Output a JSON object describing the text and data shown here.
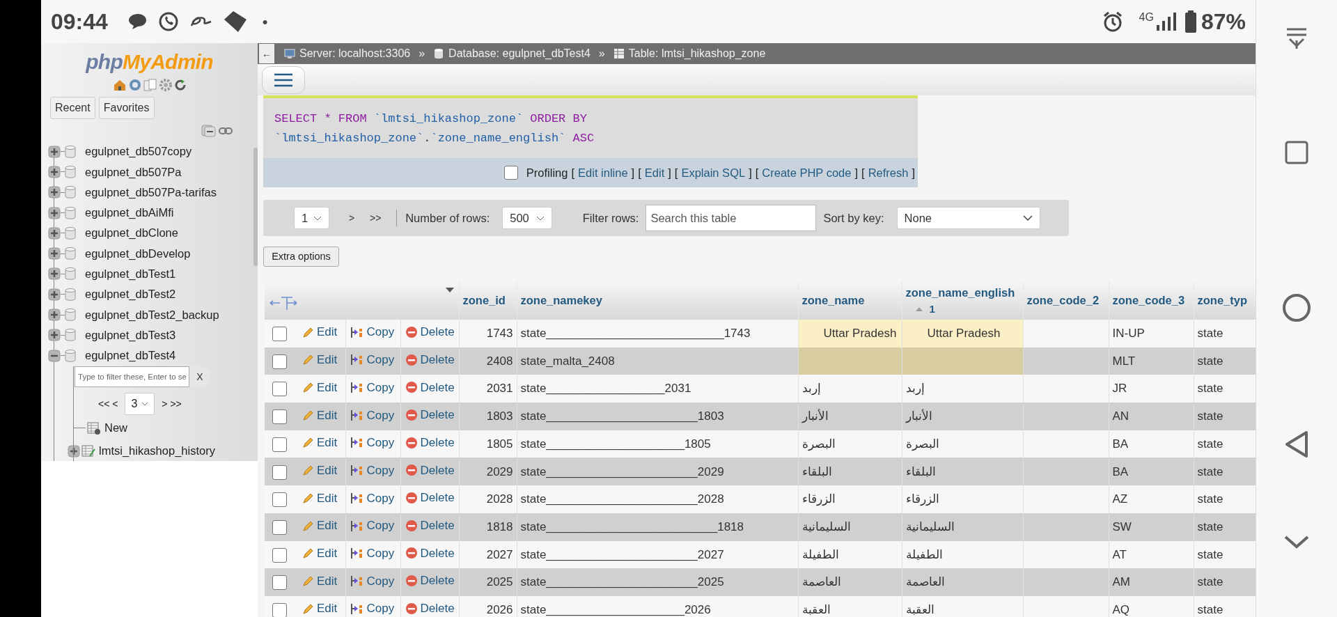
{
  "status_bar": {
    "time": "09:44",
    "dot": "•",
    "network": "4G",
    "battery": "87%"
  },
  "sidebar": {
    "logo": [
      "php",
      "MyAdmin"
    ],
    "buttons": [
      "Recent",
      "Favorites"
    ],
    "databases": [
      {
        "name": "egulpnet_db507copy",
        "expanded": false
      },
      {
        "name": "egulpnet_db507Pa",
        "expanded": false
      },
      {
        "name": "egulpnet_db507Pa-tarifas",
        "expanded": false
      },
      {
        "name": "egulpnet_dbAiMfi",
        "expanded": false
      },
      {
        "name": "egulpnet_dbClone",
        "expanded": false
      },
      {
        "name": "egulpnet_dbDevelop",
        "expanded": false
      },
      {
        "name": "egulpnet_dbTest1",
        "expanded": false
      },
      {
        "name": "egulpnet_dbTest2",
        "expanded": false
      },
      {
        "name": "egulpnet_dbTest2_backup",
        "expanded": false
      },
      {
        "name": "egulpnet_dbTest3",
        "expanded": false
      },
      {
        "name": "egulpnet_dbTest4",
        "expanded": true,
        "filter": {
          "placeholder": "Type to filter these, Enter to se",
          "clear": "X"
        },
        "pager": {
          "prev": "<< <",
          "page": "3",
          "next": "> >>"
        },
        "children": [
          {
            "kind": "new",
            "name": "New"
          },
          {
            "kind": "table",
            "name": "lmtsi_hikashop_history"
          }
        ]
      }
    ]
  },
  "breadcrumb": {
    "back": "←",
    "items": [
      {
        "kind": "server",
        "label": "Server: localhost:3306"
      },
      {
        "kind": "database",
        "label": "Database: egulpnet_dbTest4"
      },
      {
        "kind": "table",
        "label": "Table: lmtsi_hikashop_zone"
      }
    ],
    "separator": "»"
  },
  "sql": {
    "lines": [
      [
        {
          "kind": "keyword",
          "text": "SELECT"
        },
        {
          "kind": "keyword",
          "text": " * FROM "
        },
        {
          "kind": "ident",
          "text": "`lmtsi_hikashop_zone`"
        },
        {
          "kind": "keyword",
          "text": " ORDER BY"
        }
      ],
      [
        {
          "kind": "ident",
          "text": "`lmtsi_hikashop_zone`"
        },
        {
          "kind": "plain",
          "text": "."
        },
        {
          "kind": "ident",
          "text": "`zone_name_english`"
        },
        {
          "kind": "keyword",
          "text": " ASC"
        }
      ]
    ],
    "profiling": {
      "label": "Profiling",
      "checked": false
    },
    "links": [
      {
        "open": "[",
        "label": "Edit inline",
        "close": "]"
      },
      {
        "open": "[",
        "label": "Edit",
        "close": "]"
      },
      {
        "open": "[",
        "label": "Explain SQL",
        "close": "]"
      },
      {
        "open": "[",
        "label": "Create PHP code",
        "close": "]"
      },
      {
        "open": "[",
        "label": "Refresh",
        "close": "]"
      }
    ]
  },
  "navigation": {
    "page": "1",
    "next": ">",
    "last": ">>",
    "rows_label": "Number of rows:",
    "rows": "500",
    "filter_label": "Filter rows:",
    "filter_placeholder": "Search this table",
    "sort_label": "Sort by key:",
    "sort": "None",
    "extra_options": "Extra options"
  },
  "table": {
    "columns": [
      {
        "label": "zone_id"
      },
      {
        "label": "zone_namekey"
      },
      {
        "label": "zone_name"
      },
      {
        "label": "zone_name_english",
        "sort_order": "1"
      },
      {
        "label": "zone_code_2"
      },
      {
        "label": "zone_code_3"
      },
      {
        "label": "zone_typ"
      }
    ],
    "rows": [
      {
        "checked": false,
        "highlighted": true,
        "actions": [
          "Edit",
          "Copy",
          "Delete"
        ],
        "cells": [
          "1743",
          "state___________________________1743",
          "Uttar Pradesh",
          "Uttar Pradesh",
          "",
          "IN-UP",
          "state"
        ]
      },
      {
        "checked": false,
        "highlighted": true,
        "actions": [
          "Edit",
          "Copy",
          "Delete"
        ],
        "cells": [
          "2408",
          "state_malta_2408",
          "",
          "",
          "",
          "MLT",
          "state"
        ]
      },
      {
        "checked": false,
        "highlighted": false,
        "actions": [
          "Edit",
          "Copy",
          "Delete"
        ],
        "cells": [
          "2031",
          "state__________________2031",
          "إربد",
          "إربد",
          "",
          "JR",
          "state"
        ]
      },
      {
        "checked": false,
        "highlighted": false,
        "actions": [
          "Edit",
          "Copy",
          "Delete"
        ],
        "cells": [
          "1803",
          "state_______________________1803",
          "الأنبار",
          "الأنبار",
          "",
          "AN",
          "state"
        ]
      },
      {
        "checked": false,
        "highlighted": false,
        "actions": [
          "Edit",
          "Copy",
          "Delete"
        ],
        "cells": [
          "1805",
          "state_____________________1805",
          "البصرة",
          "البصرة",
          "",
          "BA",
          "state"
        ]
      },
      {
        "checked": false,
        "highlighted": false,
        "actions": [
          "Edit",
          "Copy",
          "Delete"
        ],
        "cells": [
          "2029",
          "state_______________________2029",
          "البلقاء",
          "البلقاء",
          "",
          "BA",
          "state"
        ]
      },
      {
        "checked": false,
        "highlighted": false,
        "actions": [
          "Edit",
          "Copy",
          "Delete"
        ],
        "cells": [
          "2028",
          "state_______________________2028",
          "الزرقاء",
          "الزرقاء",
          "",
          "AZ",
          "state"
        ]
      },
      {
        "checked": false,
        "highlighted": false,
        "actions": [
          "Edit",
          "Copy",
          "Delete"
        ],
        "cells": [
          "1818",
          "state__________________________1818",
          "السليمانية",
          "السليمانية",
          "",
          "SW",
          "state"
        ]
      },
      {
        "checked": false,
        "highlighted": false,
        "actions": [
          "Edit",
          "Copy",
          "Delete"
        ],
        "cells": [
          "2027",
          "state_______________________2027",
          "الطفيلة",
          "الطفيلة",
          "",
          "AT",
          "state"
        ]
      },
      {
        "checked": false,
        "highlighted": false,
        "actions": [
          "Edit",
          "Copy",
          "Delete"
        ],
        "cells": [
          "2025",
          "state_______________________2025",
          "العاصمة",
          "العاصمة",
          "",
          "AM",
          "state"
        ]
      },
      {
        "checked": false,
        "highlighted": false,
        "actions": [
          "Edit",
          "Copy",
          "Delete"
        ],
        "cells": [
          "2026",
          "state_____________________2026",
          "العقبة",
          "العقبة",
          "",
          "AQ",
          "state"
        ]
      }
    ]
  }
}
